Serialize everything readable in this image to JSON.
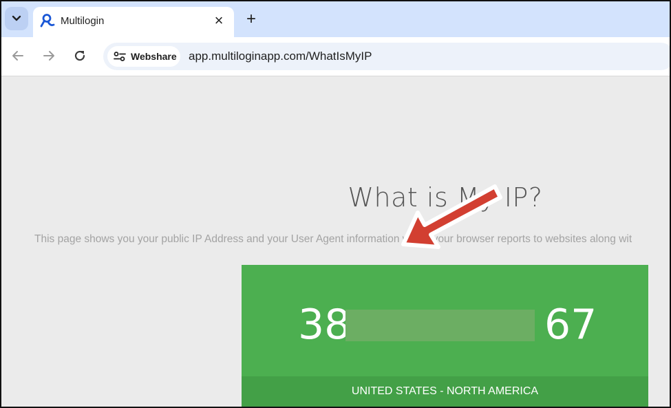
{
  "tabstrip": {
    "menu_icon": "chevron-down-icon",
    "tab": {
      "title": "Multilogin",
      "favicon": "multilogin-logo-icon",
      "close": "×"
    },
    "new_tab": "+"
  },
  "toolbar": {
    "back_icon": "back-arrow-icon",
    "forward_icon": "forward-arrow-icon",
    "reload_icon": "reload-icon",
    "site_chip_label": "Webshare",
    "url": "app.multiloginapp.com/WhatIsMyIP"
  },
  "page": {
    "title": "What is My IP?",
    "description": "This page shows you your public IP Address and your User Agent information which your browser reports to websites along wit",
    "ip_visible_start": "38",
    "ip_visible_end": "67",
    "location": "UNITED STATES - NORTH AMERICA"
  },
  "colors": {
    "card_green": "#4caf50",
    "location_green": "#43a047",
    "annotation_red": "#d23f31",
    "tabstrip_blue": "#d3e3fd"
  }
}
